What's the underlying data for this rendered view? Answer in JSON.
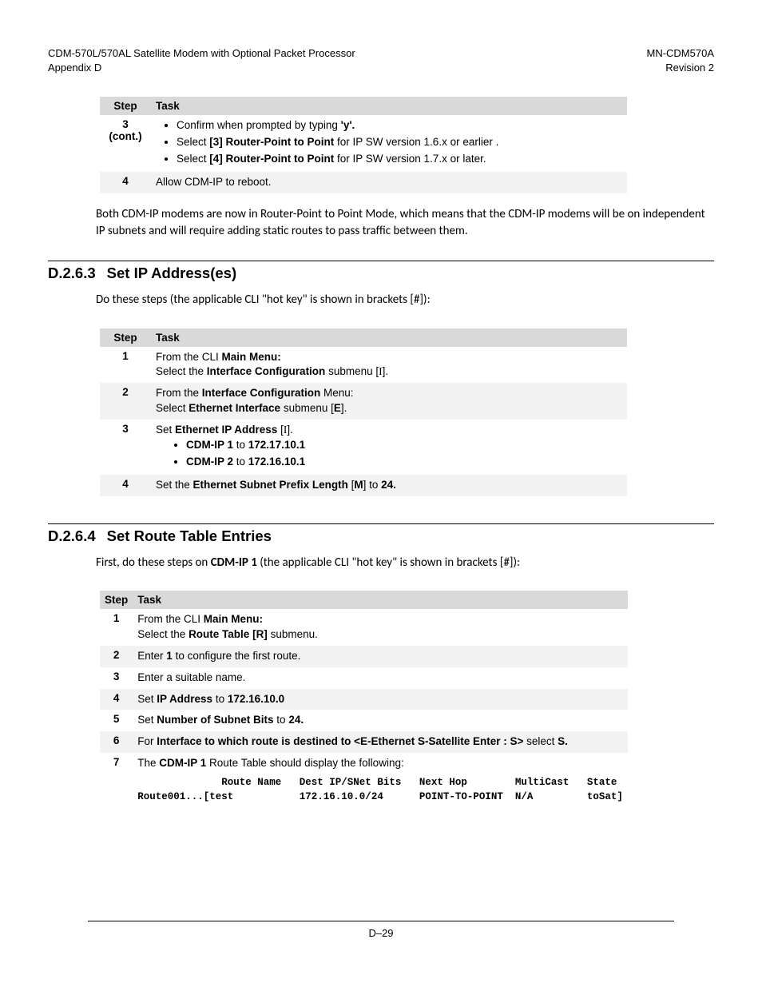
{
  "header": {
    "left_line1": "CDM-570L/570AL Satellite Modem with Optional Packet Processor",
    "left_line2": "Appendix D",
    "right_line1": "MN-CDM570A",
    "right_line2": "Revision 2"
  },
  "table1": {
    "head_step": "Step",
    "head_task": "Task",
    "rows": [
      {
        "step": "3 (cont.)",
        "bullets": [
          {
            "pre": "Confirm when prompted by typing ",
            "b1": "'y'.",
            "post": ""
          },
          {
            "pre": "Select ",
            "b1": "[3] Router-Point to Point",
            "post": " for IP SW version 1.6.x or earlier ."
          },
          {
            "pre": "Select ",
            "b1": "[4] Router-Point to Point",
            "post": "  for IP SW version 1.7.x or later."
          }
        ]
      },
      {
        "step": "4",
        "text": "Allow CDM-IP to reboot."
      }
    ]
  },
  "p1": "Both CDM-IP modems are now in Router-Point to Point Mode, which means that the CDM-IP modems will be on independent IP subnets and will require adding static routes to pass traffic between them.",
  "sec263": {
    "num": "D.2.6.3",
    "title": "Set IP Address(es)",
    "intro": "Do these steps (the applicable CLI \"hot key\" is shown in brackets [#]):"
  },
  "table2": {
    "head_step": "Step",
    "head_task": "Task",
    "row1_step": "1",
    "row1_a": "From the CLI ",
    "row1_b": "Main Menu:",
    "row1_c": "Select the ",
    "row1_d": "Interface Configuration",
    "row1_e": " submenu [",
    "row1_f": "I",
    "row1_g": "].",
    "row2_step": "2",
    "row2_a": "From the ",
    "row2_b": "Interface Configuration",
    "row2_c": " Menu:",
    "row2_d": "Select ",
    "row2_e": "Ethernet Interface",
    "row2_f": " submenu [",
    "row2_g": "E",
    "row2_h": "].",
    "row3_step": "3",
    "row3_a": "Set ",
    "row3_b": "Ethernet IP Address",
    "row3_c": " [",
    "row3_d": "I",
    "row3_e": "].",
    "row3_li1a": "CDM-IP 1",
    "row3_li1b": " to ",
    "row3_li1c": "172.17.10.1",
    "row3_li2a": "CDM-IP 2",
    "row3_li2b": " to ",
    "row3_li2c": "172.16.10.1",
    "row4_step": "4",
    "row4_a": "Set the ",
    "row4_b": "Ethernet Subnet Prefix Length",
    "row4_c": " [",
    "row4_d": "M",
    "row4_e": "] to ",
    "row4_f": "24.",
    "row4_g": ""
  },
  "sec264": {
    "num": "D.2.6.4",
    "title": "Set Route Table Entries",
    "intro_a": "First, do these steps on ",
    "intro_b": "CDM-IP 1",
    "intro_c": " (the applicable CLI \"hot key\" is shown in brackets [#]):"
  },
  "table3": {
    "head_step": "Step",
    "head_task": "Task",
    "r1_step": "1",
    "r1_a": "From the CLI ",
    "r1_b": "Main Menu:",
    "r1_c": "Select the  ",
    "r1_d": "Route Table [R]",
    "r1_e": " submenu.",
    "r2_step": "2",
    "r2_a": "Enter ",
    "r2_b": "1",
    "r2_c": " to configure the first route.",
    "r3_step": "3",
    "r3_a": "Enter a suitable name.",
    "r4_step": "4",
    "r4_a": "Set ",
    "r4_b": "IP Address",
    "r4_c": " to ",
    "r4_d": "172.16.10.0",
    "r5_step": "5",
    "r5_a": "Set ",
    "r5_b": "Number of Subnet Bits",
    "r5_c": " to ",
    "r5_d": "24.",
    "r6_step": "6",
    "r6_a": "For ",
    "r6_b": "Interface to which route is destined to <E-Ethernet S-Satellite Enter : S>",
    "r6_c": " select ",
    "r6_d": "S.",
    "r7_step": "7",
    "r7_a": "The ",
    "r7_b": "CDM-IP 1",
    "r7_c": " Route Table should display the following:",
    "r7_mono1": "              Route Name   Dest IP/SNet Bits   Next Hop        MultiCast   State",
    "r7_mono2": "Route001...[test           172.16.10.0/24      POINT-TO-POINT  N/A         toSat]"
  },
  "page_number": "D–29"
}
